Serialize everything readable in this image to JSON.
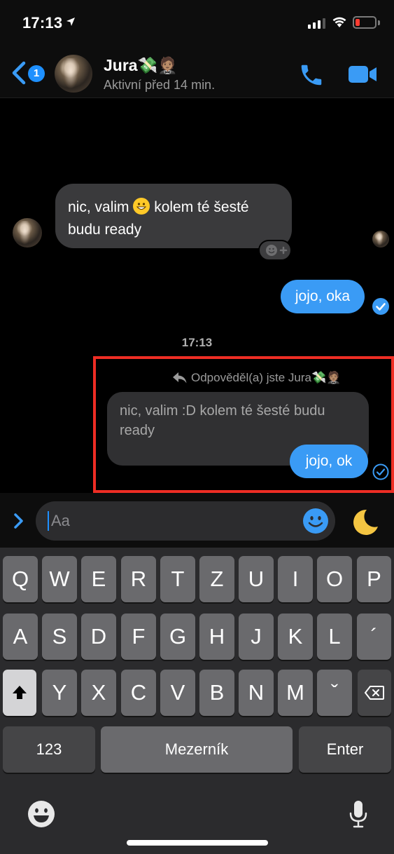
{
  "status_bar": {
    "time": "17:13"
  },
  "header": {
    "back_badge": "1",
    "contact_name": "Jura💸🤵🏽",
    "contact_status": "Aktivní před 14 min."
  },
  "messages": {
    "incoming_text_before": "nic, valim ",
    "incoming_text_after": " kolem té šesté budu ready",
    "outgoing_1": "jojo, oka",
    "time_separator": "17:13",
    "reply_label": "Odpověděl(a) jste Jura💸🤵🏽",
    "quoted_text": "nic, valim :D kolem té šesté budu ready",
    "outgoing_2": "jojo, ok"
  },
  "composer": {
    "placeholder": "Aa"
  },
  "keyboard": {
    "row1": [
      "Q",
      "W",
      "E",
      "R",
      "T",
      "Z",
      "U",
      "I",
      "O",
      "P"
    ],
    "row2": [
      "A",
      "S",
      "D",
      "F",
      "G",
      "H",
      "J",
      "K",
      "L",
      "´"
    ],
    "row3": [
      "Y",
      "X",
      "C",
      "V",
      "B",
      "N",
      "M",
      "ˇ"
    ],
    "numbers_label": "123",
    "space_label": "Mezerník",
    "enter_label": "Enter"
  },
  "colors": {
    "accent": "#3a9bf5",
    "highlight": "#ee2d24"
  },
  "icons": [
    "location-arrow-icon",
    "signal-icon",
    "wifi-icon",
    "battery-icon",
    "back-chevron-icon",
    "phone-icon",
    "video-icon",
    "add-reaction-icon",
    "read-check-icon",
    "reply-arrow-icon",
    "expand-icon",
    "emoji-icon",
    "moon-icon",
    "shift-icon",
    "backspace-icon",
    "keyboard-emoji-icon",
    "microphone-icon"
  ]
}
